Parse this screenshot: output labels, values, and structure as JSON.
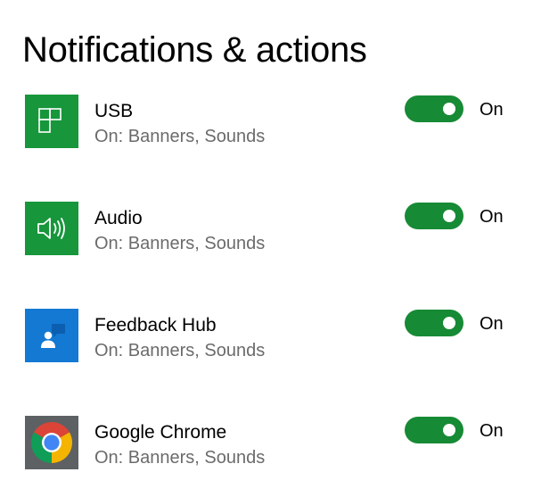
{
  "page": {
    "title": "Notifications & actions"
  },
  "colors": {
    "toggle_on": "#168a34",
    "usb_tile": "#17963b",
    "audio_tile": "#17963b",
    "feedback_tile": "#1479d2",
    "chrome_tile": "#5e6164",
    "secondary_text": "#6b6b6b"
  },
  "apps": [
    {
      "name": "USB",
      "status": "On: Banners, Sounds",
      "icon": "usb-app-icon",
      "toggle_label": "On",
      "toggle_on": true
    },
    {
      "name": "Audio",
      "status": "On: Banners, Sounds",
      "icon": "speaker-icon",
      "toggle_label": "On",
      "toggle_on": true
    },
    {
      "name": "Feedback Hub",
      "status": "On: Banners, Sounds",
      "icon": "feedback-hub-icon",
      "toggle_label": "On",
      "toggle_on": true
    },
    {
      "name": "Google Chrome",
      "status": "On: Banners, Sounds",
      "icon": "chrome-icon",
      "toggle_label": "On",
      "toggle_on": true
    }
  ]
}
